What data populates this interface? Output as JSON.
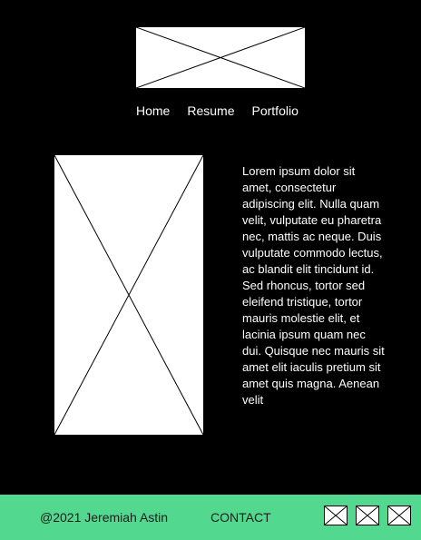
{
  "header": {
    "logo_icon": "image-placeholder-icon",
    "nav": {
      "home": "Home",
      "resume": "Resume",
      "portfolio": "Portfolio"
    }
  },
  "main": {
    "image_icon": "image-placeholder-icon",
    "body_text": "Lorem ipsum dolor sit amet, consectetur adipiscing elit. Nulla quam velit, vulputate eu pharetra nec, mattis ac neque. Duis vulputate commodo lectus, ac blandit elit tincidunt id. Sed rhoncus, tortor sed eleifend tristique, tortor mauris molestie elit, et lacinia ipsum quam nec dui. Quisque nec mauris sit amet elit iaculis pretium sit amet quis magna. Aenean velit"
  },
  "footer": {
    "copyright": "@2021 Jeremiah Astin",
    "contact": "CONTACT",
    "social_icons": [
      "image-placeholder-icon",
      "image-placeholder-icon",
      "image-placeholder-icon"
    ]
  },
  "colors": {
    "background": "#000000",
    "footer_background": "#52d98f",
    "placeholder": "#ffffff"
  }
}
